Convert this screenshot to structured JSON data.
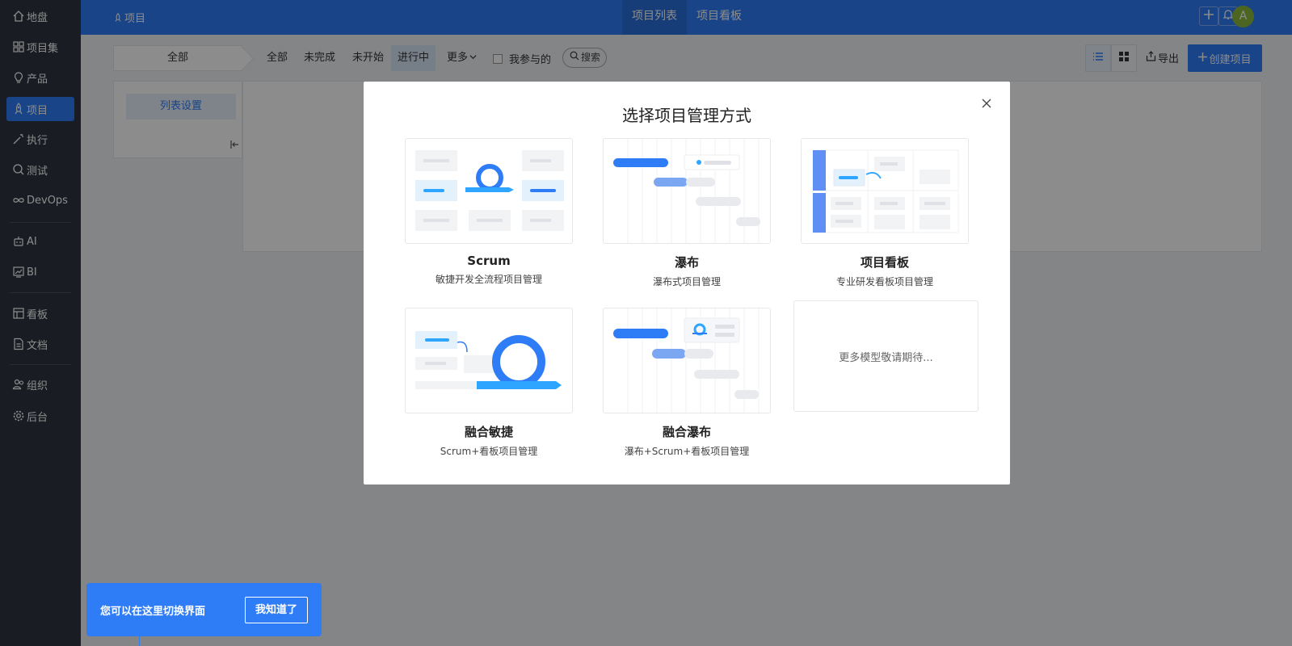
{
  "sidebar": {
    "items": [
      {
        "label": "地盘",
        "icon": "home-icon"
      },
      {
        "label": "项目集",
        "icon": "grid-icon"
      },
      {
        "label": "产品",
        "icon": "bulb-icon"
      },
      {
        "label": "项目",
        "icon": "rocket-icon",
        "active": true
      },
      {
        "label": "执行",
        "icon": "wand-icon"
      },
      {
        "label": "测试",
        "icon": "magnifier-icon"
      },
      {
        "label": "DevOps",
        "icon": "infinity-icon"
      },
      {
        "label": "AI",
        "icon": "robot-icon"
      },
      {
        "label": "BI",
        "icon": "chart-icon"
      },
      {
        "label": "看板",
        "icon": "kanban-icon"
      },
      {
        "label": "文档",
        "icon": "document-icon"
      },
      {
        "label": "组织",
        "icon": "users-icon"
      },
      {
        "label": "后台",
        "icon": "gear-icon"
      }
    ]
  },
  "header": {
    "breadcrumb": "项目",
    "tabs": [
      "项目列表",
      "项目看板"
    ],
    "avatar": "A"
  },
  "toolbar": {
    "scope": "全部",
    "filters": [
      "全部",
      "未完成",
      "未开始",
      "进行中",
      "更多"
    ],
    "involved_label": "我参与的",
    "search_label": "搜索",
    "export_label": "导出",
    "create_label": "创建项目"
  },
  "left_panel": {
    "list_settings": "列表设置"
  },
  "modal": {
    "title": "选择项目管理方式",
    "cards": [
      {
        "title": "Scrum",
        "desc": "敏捷开发全流程项目管理"
      },
      {
        "title": "瀑布",
        "desc": "瀑布式项目管理"
      },
      {
        "title": "项目看板",
        "desc": "专业研发看板项目管理"
      },
      {
        "title": "融合敏捷",
        "desc": "Scrum+看板项目管理"
      },
      {
        "title": "融合瀑布",
        "desc": "瀑布+Scrum+看板项目管理"
      }
    ],
    "more_text": "更多模型敬请期待..."
  },
  "tip": {
    "text": "您可以在这里切换界面",
    "button": "我知道了"
  },
  "colors": {
    "accent": "#2e7cf6",
    "sidebar_bg": "#2f3640",
    "avatar_bg": "#8aba3c"
  }
}
